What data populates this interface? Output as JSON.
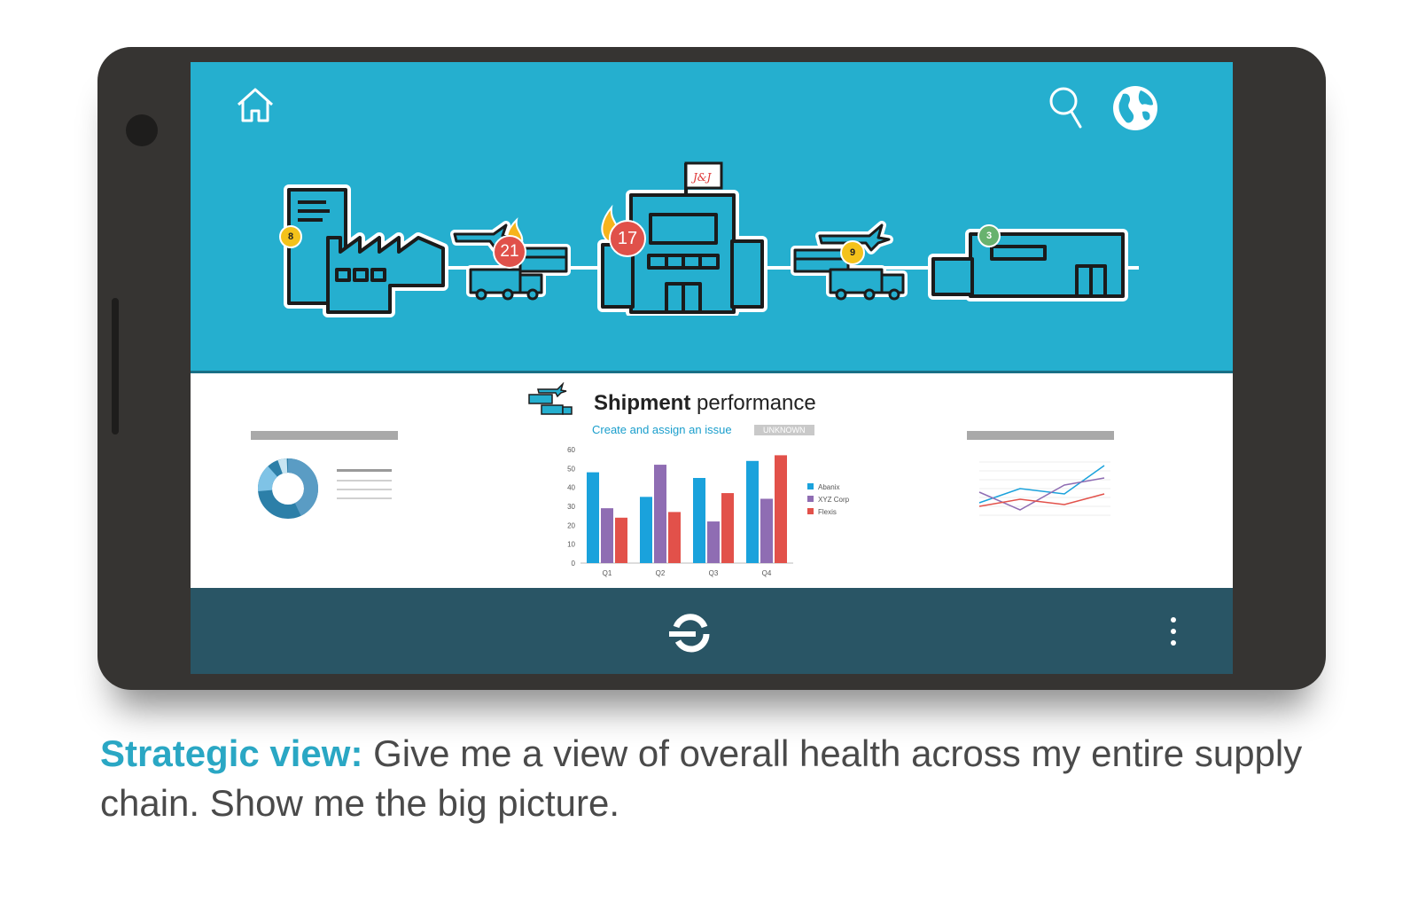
{
  "header": {
    "home_icon": "home-icon",
    "search_icon": "search-icon",
    "globe_icon": "globe-icon"
  },
  "supply_chain": {
    "nodes": [
      {
        "name": "supplier-factory",
        "badge": "8",
        "badge_color": "#f4c21b"
      },
      {
        "name": "inbound-logistics",
        "badge": "21",
        "badge_color": "#e0514a"
      },
      {
        "name": "headquarters",
        "badge": "17",
        "badge_color": "#e0514a"
      },
      {
        "name": "outbound-logistics",
        "badge": "9",
        "badge_color": "#f4c21b"
      },
      {
        "name": "distribution-warehouse",
        "badge": "3",
        "badge_color": "#68b26e"
      }
    ],
    "flag_text": "J&J"
  },
  "performance": {
    "title_bold": "Shipment",
    "title_rest": " performance",
    "action_link": "Create and assign an issue",
    "status_tag": "UNKNOWN"
  },
  "chart_data": {
    "type": "bar",
    "categories": [
      "Q1",
      "Q2",
      "Q3",
      "Q4"
    ],
    "ylim": [
      0,
      60
    ],
    "yticks": [
      0,
      10,
      20,
      30,
      40,
      50,
      60
    ],
    "series": [
      {
        "name": "Abanix",
        "color": "#1aa2dc",
        "values": [
          48,
          35,
          45,
          54
        ]
      },
      {
        "name": "XYZ Corp",
        "color": "#8f6db3",
        "values": [
          29,
          52,
          22,
          34
        ]
      },
      {
        "name": "Flexis",
        "color": "#e2514a",
        "values": [
          24,
          27,
          37,
          57
        ]
      }
    ]
  },
  "footer": {
    "logo_icon": "app-logo-icon",
    "menu_icon": "more-vert-icon"
  },
  "caption": {
    "lead": "Strategic view:",
    "text": " Give me a view of overall health across my entire supply chain. Show me the big picture."
  },
  "colors": {
    "hero_bg": "#25afcf",
    "footer_bg": "#295565",
    "accent": "#2aa7c4"
  }
}
